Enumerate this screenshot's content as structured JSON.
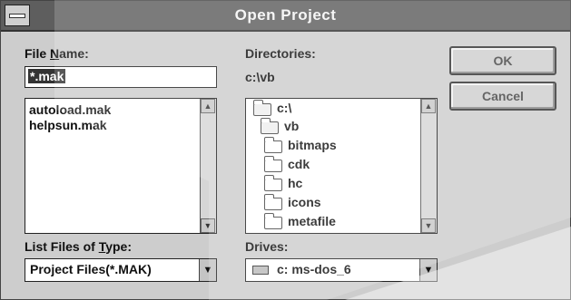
{
  "window": {
    "title": "Open Project"
  },
  "file_name": {
    "label_pre": "File ",
    "label_key": "N",
    "label_post": "ame:",
    "value": "*.mak",
    "files": [
      "autoload.mak",
      "helpsun.mak"
    ]
  },
  "directories": {
    "label": "Directories:",
    "current_path": "c:\\vb",
    "items": [
      "c:\\",
      "vb",
      "bitmaps",
      "cdk",
      "hc",
      "icons",
      "metafile"
    ]
  },
  "buttons": {
    "ok": "OK",
    "cancel": "Cancel"
  },
  "file_type": {
    "label_pre": "List Files of ",
    "label_key": "T",
    "label_post": "ype:",
    "selected": "Project Files(*.MAK)"
  },
  "drives": {
    "label": "Drives:",
    "selected": "c: ms-dos_6"
  },
  "icons": {
    "system_menu": "system-menu-icon",
    "folder": "folder-icon",
    "drive": "hard-drive-icon",
    "scroll_up": "▲",
    "scroll_down": "▼"
  }
}
